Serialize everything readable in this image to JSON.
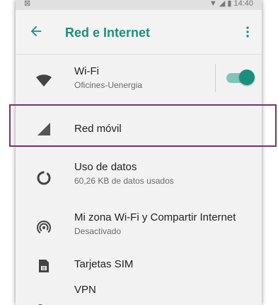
{
  "status_bar": {
    "left": "⊠",
    "right": "▼ ◢ ▮ 14:40"
  },
  "app_bar": {
    "title": "Red e Internet",
    "back_icon": "arrow-back-icon",
    "menu_icon": "more-vert-icon"
  },
  "accent_color": "#1f8f7a",
  "highlight_color": "#7a3170",
  "items": [
    {
      "title": "Wi-Fi",
      "subtitle": "Oficines-Uenergia",
      "icon": "wifi-icon",
      "toggle_on": true
    },
    {
      "title": "Red móvil",
      "icon": "mobile-signal-icon"
    },
    {
      "title": "Uso de datos",
      "subtitle": "60,26 KB de datos usados",
      "icon": "data-usage-icon"
    },
    {
      "title": "Mi zona Wi-Fi y Compartir Internet",
      "subtitle": "Desactivado",
      "icon": "hotspot-icon"
    },
    {
      "title": "Tarjetas SIM",
      "icon": "sim-card-icon"
    },
    {
      "title": "VPN",
      "icon": "vpn-key-icon"
    }
  ]
}
